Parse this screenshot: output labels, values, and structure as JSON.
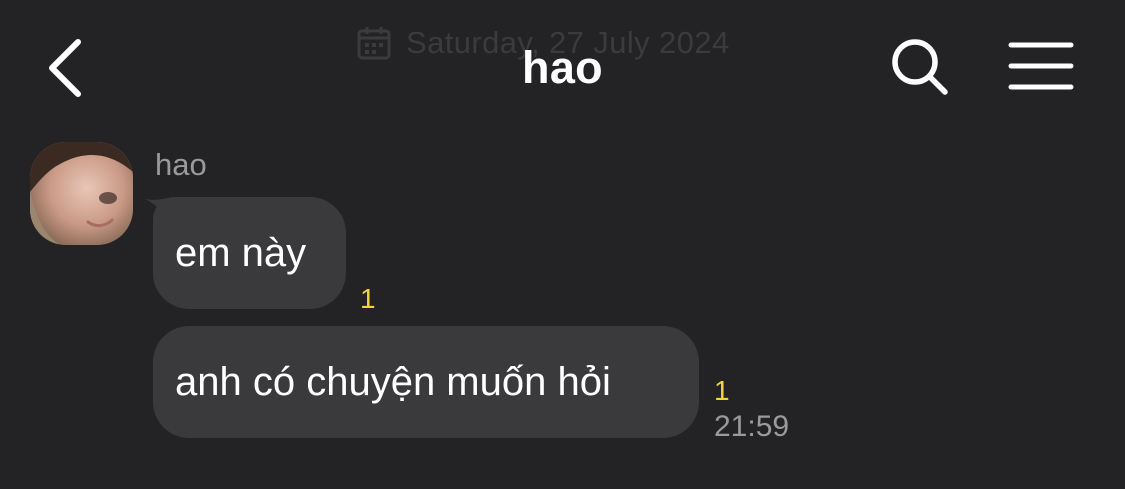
{
  "header": {
    "title": "hao",
    "date_divider": "Saturday, 27 July 2024",
    "back_icon": "chevron-left-icon",
    "search_icon": "search-icon",
    "menu_icon": "hamburger-menu-icon"
  },
  "messages": [
    {
      "sender": "hao",
      "text": "em này",
      "unread": "1"
    },
    {
      "text": "anh có chuyện muốn hỏi",
      "unread": "1",
      "time": "21:59"
    }
  ],
  "colors": {
    "background": "#232325",
    "bubble": "#3a3a3c",
    "unread": "#f2d53c",
    "muted_text": "#9a9a9c"
  }
}
